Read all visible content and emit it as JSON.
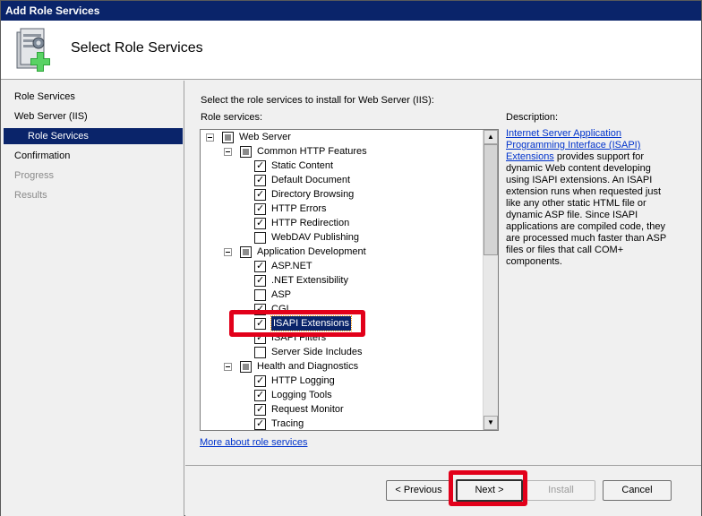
{
  "window": {
    "title": "Add Role Services"
  },
  "header": {
    "title": "Select Role Services",
    "icon": "server-add-icon"
  },
  "nav": {
    "items": [
      {
        "label": "Role Services",
        "state": "normal"
      },
      {
        "label": "Web Server (IIS)",
        "state": "normal"
      },
      {
        "label": "Role Services",
        "state": "active"
      },
      {
        "label": "Confirmation",
        "state": "normal"
      },
      {
        "label": "Progress",
        "state": "dim"
      },
      {
        "label": "Results",
        "state": "dim"
      }
    ]
  },
  "main": {
    "instruction": "Select the role services to install for Web Server (IIS):",
    "role_services_label": "Role services:",
    "description_label": "Description:",
    "description_link": "Internet Server Application Programming Interface (ISAPI) Extensions",
    "description_text": " provides support for dynamic Web content developing using ISAPI extensions. An ISAPI extension runs when requested just like any other static HTML file or dynamic ASP file. Since ISAPI applications are compiled code, they are processed much faster than ASP files or files that call COM+ components.",
    "more_link": "More about role services",
    "tree": [
      {
        "label": "Web Server",
        "level": 0,
        "state": "partial",
        "expander": true
      },
      {
        "label": "Common HTTP Features",
        "level": 1,
        "state": "partial",
        "expander": true
      },
      {
        "label": "Static Content",
        "level": 2,
        "state": "checked"
      },
      {
        "label": "Default Document",
        "level": 2,
        "state": "checked"
      },
      {
        "label": "Directory Browsing",
        "level": 2,
        "state": "checked"
      },
      {
        "label": "HTTP Errors",
        "level": 2,
        "state": "checked"
      },
      {
        "label": "HTTP Redirection",
        "level": 2,
        "state": "checked"
      },
      {
        "label": "WebDAV Publishing",
        "level": 2,
        "state": "unchecked"
      },
      {
        "label": "Application Development",
        "level": 1,
        "state": "partial",
        "expander": true
      },
      {
        "label": "ASP.NET",
        "level": 2,
        "state": "checked"
      },
      {
        "label": ".NET Extensibility",
        "level": 2,
        "state": "checked"
      },
      {
        "label": "ASP",
        "level": 2,
        "state": "unchecked"
      },
      {
        "label": "CGI",
        "level": 2,
        "state": "checked"
      },
      {
        "label": "ISAPI Extensions",
        "level": 2,
        "state": "checked",
        "selected": true
      },
      {
        "label": "ISAPI Filters",
        "level": 2,
        "state": "checked"
      },
      {
        "label": "Server Side Includes",
        "level": 2,
        "state": "unchecked"
      },
      {
        "label": "Health and Diagnostics",
        "level": 1,
        "state": "partial",
        "expander": true
      },
      {
        "label": "HTTP Logging",
        "level": 2,
        "state": "checked"
      },
      {
        "label": "Logging Tools",
        "level": 2,
        "state": "checked"
      },
      {
        "label": "Request Monitor",
        "level": 2,
        "state": "checked"
      },
      {
        "label": "Tracing",
        "level": 2,
        "state": "checked"
      }
    ]
  },
  "footer": {
    "previous": "< Previous",
    "next": "Next >",
    "install": "Install",
    "cancel": "Cancel"
  },
  "colors": {
    "selection": "#0a246a",
    "highlight": "#e2001a",
    "link": "#0033cc"
  }
}
